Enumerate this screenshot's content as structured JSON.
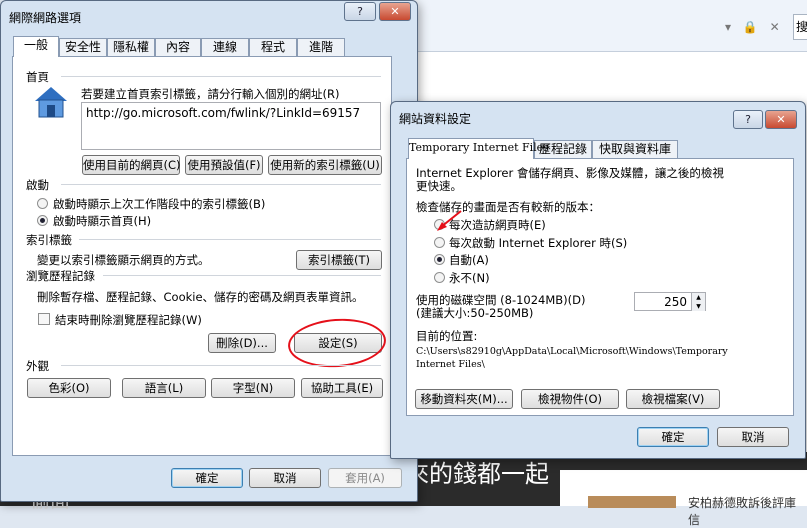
{
  "background": {
    "search_hint": "搜",
    "band_text": "來的錢都一起",
    "band_text_left": "偷面",
    "article_snippet": "安柏赫德敗訴後評庫信"
  },
  "inet_options": {
    "title": "網際網路選項",
    "help_label": "?",
    "close_label": "✕",
    "tabs": [
      "一般",
      "安全性",
      "隱私權",
      "內容",
      "連線",
      "程式",
      "進階"
    ],
    "home_page": {
      "heading": "首頁",
      "instruction": "若要建立首頁索引標籤，請分行輸入個別的網址(R)",
      "url": "http://go.microsoft.com/fwlink/?LinkId=69157",
      "btn_current": "使用目前的網頁(C)",
      "btn_default": "使用預設值(F)",
      "btn_new_tab": "使用新的索引標籤(U)"
    },
    "startup": {
      "heading": "啟動",
      "option_last_session": "啟動時顯示上次工作階段中的索引標籤(B)",
      "option_home": "啟動時顯示首頁(H)"
    },
    "tabs_section": {
      "heading": "索引標籤",
      "description": "變更以索引標籤顯示網頁的方式。",
      "button": "索引標籤(T)"
    },
    "history": {
      "heading": "瀏覽歷程記錄",
      "description": "刪除暫存檔、歷程記錄、Cookie、儲存的密碼及網頁表單資訊。",
      "checkbox": "結束時刪除瀏覽歷程記錄(W)",
      "delete_button": "刪除(D)...",
      "settings_button": "設定(S)"
    },
    "appearance": {
      "heading": "外觀",
      "colors": "色彩(O)",
      "languages": "語言(L)",
      "fonts": "字型(N)",
      "accessibility": "協助工具(E)"
    },
    "footer": {
      "ok": "確定",
      "cancel": "取消",
      "apply": "套用(A)"
    }
  },
  "site_settings": {
    "title": "網站資料設定",
    "help_label": "?",
    "close_label": "✕",
    "tabs": [
      "Temporary Internet Files",
      "歷程記錄",
      "快取與資料庫"
    ],
    "description": "Internet Explorer 會儲存網頁、影像及媒體，讓之後的檢視更快速。",
    "check_heading": "檢查儲存的畫面是否有較新的版本：",
    "options": [
      "每次造訪網頁時(E)",
      "每次啟動 Internet Explorer 時(S)",
      "自動(A)",
      "永不(N)"
    ],
    "selected_option": "自動(A)",
    "disk_label": "使用的磁碟空間 (8-1024MB)(D)",
    "disk_hint": "(建議大小:50-250MB)",
    "disk_value": "250",
    "location_label": "目前的位置:",
    "location_path_1": "C:\\Users\\s82910g\\AppData\\Local\\Microsoft\\Windows\\Temporary",
    "location_path_2": "Internet Files\\",
    "btn_move": "移動資料夾(M)...",
    "btn_view_objects": "檢視物件(O)",
    "btn_view_files": "檢視檔案(V)",
    "ok": "確定",
    "cancel": "取消"
  }
}
